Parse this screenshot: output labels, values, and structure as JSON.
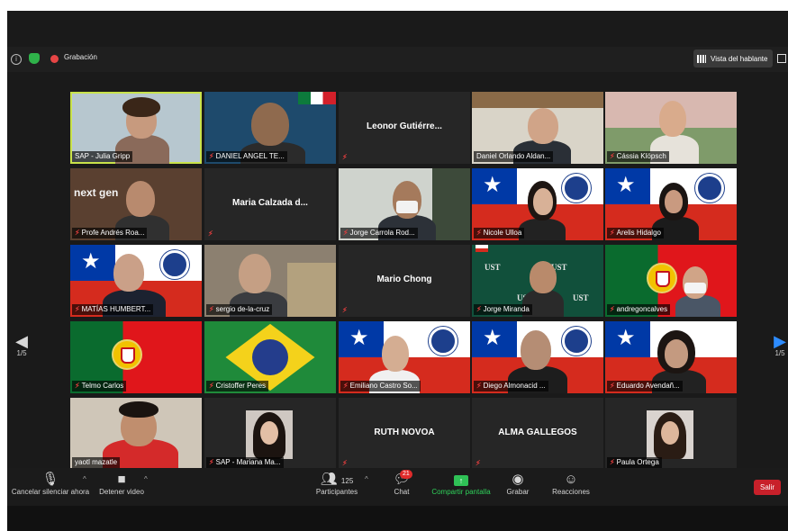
{
  "topbar": {
    "recording_label": "Grabación",
    "view_label": "Vista del hablante"
  },
  "navigation": {
    "page_left": "1/5",
    "page_right": "1/5"
  },
  "participants": [
    {
      "name": "SAP - Julia Gripp"
    },
    {
      "name": "DANIEL ANGEL TE..."
    },
    {
      "name": "Leonor  Gutiérre..."
    },
    {
      "name": "Daniel Orlando Aldan..."
    },
    {
      "name": "Cássia Klöpsch"
    },
    {
      "name": "Profe Andrés Roa..."
    },
    {
      "name": "Maria  Calzada  d..."
    },
    {
      "name": "Jorge Carrola Rod..."
    },
    {
      "name": "Nicole Ulloa"
    },
    {
      "name": "Arelis Hidalgo"
    },
    {
      "name": "MATÍAS HUMBERT..."
    },
    {
      "name": "sergio de-la-cruz"
    },
    {
      "name": "Mario Chong"
    },
    {
      "name": "Jorge Miranda"
    },
    {
      "name": "andregoncalves"
    },
    {
      "name": "Telmo Carlos"
    },
    {
      "name": "Cristoffer Peres"
    },
    {
      "name": "Emiliano Castro So..."
    },
    {
      "name": "Diego Almonacid ..."
    },
    {
      "name": "Eduardo Avendañ..."
    },
    {
      "name": "yaotl mazatle"
    },
    {
      "name": "SAP - Mariana Ma..."
    },
    {
      "name": "RUTH NOVOA"
    },
    {
      "name": "ALMA GALLEGOS"
    },
    {
      "name": "Paula Ortega"
    }
  ],
  "backgrounds": {
    "nextgen": "next gen",
    "ust": "UST"
  },
  "controls": {
    "mute": "Cancelar silenciar ahora",
    "video": "Detener video",
    "participants": "Participantes",
    "participants_count": "125",
    "chat": "Chat",
    "chat_badge": "21",
    "share": "Compartir pantalla",
    "record": "Grabar",
    "reactions": "Reacciones",
    "leave": "Salir"
  },
  "colors": {
    "accent": "#2d8cff",
    "active_speaker": "#c9e24a",
    "share_green": "#2fc156",
    "leave_red": "#c8202a",
    "muted_red": "#e03d3d"
  }
}
